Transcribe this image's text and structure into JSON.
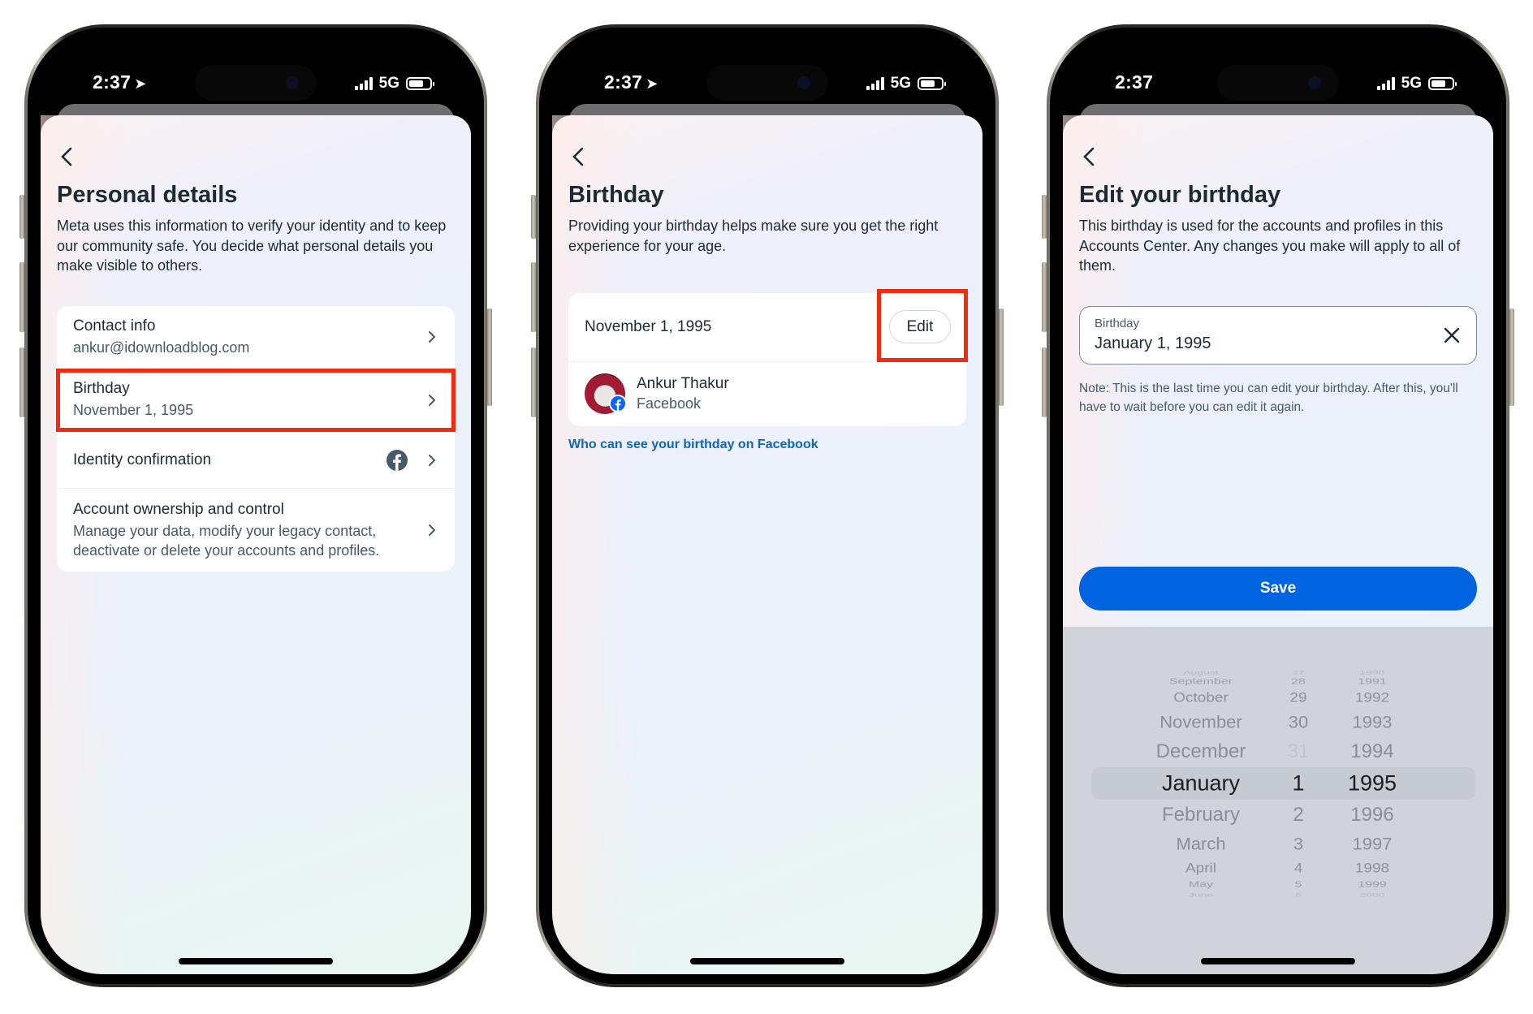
{
  "status_bar": {
    "phone1": {
      "time": "2:37",
      "location_icon": true,
      "network": "5G"
    },
    "phone2": {
      "time": "2:37",
      "location_icon": true,
      "network": "5G"
    },
    "phone3": {
      "time": "2:37",
      "location_icon": false,
      "network": "5G"
    }
  },
  "colors": {
    "highlight_box": "#f02c10",
    "primary_button": "#0064e0",
    "link": "#1165b5",
    "text_primary": "#1c2b33",
    "text_secondary": "#465a69",
    "picker_bg": "#d0d4da"
  },
  "screen1": {
    "title": "Personal details",
    "description": "Meta uses this information to verify your identity and to keep our community safe. You decide what personal details you make visible to others.",
    "items": [
      {
        "title": "Contact info",
        "subtitle": "ankur@idownloadblog.com",
        "highlighted": false
      },
      {
        "title": "Birthday",
        "subtitle": "November 1, 1995",
        "highlighted": true
      },
      {
        "title": "Identity confirmation",
        "subtitle": "",
        "icon": "facebook-icon",
        "highlighted": false
      },
      {
        "title": "Account ownership and control",
        "subtitle": "Manage your data, modify your legacy contact, deactivate or delete your accounts and profiles.",
        "highlighted": false
      }
    ]
  },
  "screen2": {
    "title": "Birthday",
    "description": "Providing your birthday helps make sure you get the right experience for your age.",
    "birthday_value": "November 1, 1995",
    "edit_label": "Edit",
    "account": {
      "name": "Ankur Thakur",
      "platform": "Facebook"
    },
    "link": "Who can see your birthday on Facebook"
  },
  "screen3": {
    "title": "Edit your birthday",
    "description": "This birthday is used for the accounts and profiles in this Accounts Center. Any changes you make will apply to all of them.",
    "field_label": "Birthday",
    "field_value": "January 1, 1995",
    "note": "Note: This is the last time you can edit your birthday. After this, you'll have to wait before you can edit it again.",
    "save_label": "Save",
    "picker": {
      "months": [
        "August",
        "September",
        "October",
        "November",
        "December",
        "January",
        "February",
        "March",
        "April",
        "May",
        "June"
      ],
      "days": [
        "27",
        "28",
        "29",
        "30",
        "31",
        "1",
        "2",
        "3",
        "4",
        "5",
        "6"
      ],
      "years": [
        "1990",
        "1991",
        "1992",
        "1993",
        "1994",
        "1995",
        "1996",
        "1997",
        "1998",
        "1999",
        "2000"
      ],
      "selected": {
        "month": "January",
        "day": "1",
        "year": "1995"
      }
    }
  }
}
